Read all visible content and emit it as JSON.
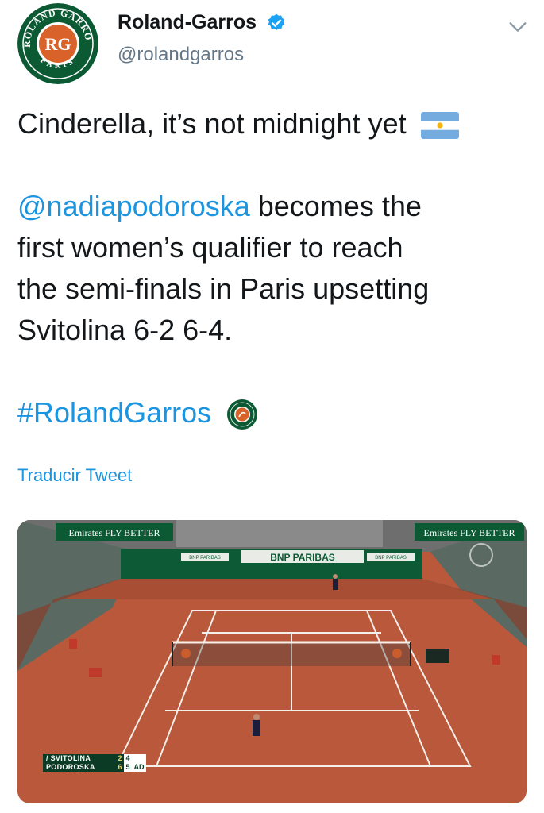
{
  "tweet": {
    "author": {
      "display_name": "Roland-Garros",
      "handle": "@rolandgarros",
      "verified": true,
      "avatar_logo_text_top": "ROLAND GARROS",
      "avatar_logo_text_bottom": "PARIS",
      "avatar_logo_monogram": "RG"
    },
    "text": {
      "line1": "Cinderella, it’s not midnight yet",
      "flag_icon": "argentina-flag-icon",
      "mention": "@nadiapodoroska",
      "line2_rest": " becomes the",
      "line3": "first women’s qualifier to reach",
      "line4": "the semi-finals in Paris upsetting",
      "line5": "Svitolina 6-2 6-4.",
      "hashtag": "#RolandGarros"
    },
    "translate_label": "Traducir Tweet",
    "menu_icon": "chevron-down-icon"
  },
  "media": {
    "board_left": "Emirates FLY BETTER",
    "board_right": "Emirates FLY BETTER",
    "sponsor_center": "BNP PARIBAS",
    "sponsor_small": "BNP PARIBAS",
    "scoreboard": {
      "player1": {
        "name": "/ SVITOLINA",
        "sets": "2",
        "games": "4",
        "points": ""
      },
      "player2": {
        "name": "PODOROSKA",
        "sets": "6",
        "games": "5",
        "points": "AD"
      }
    }
  },
  "colors": {
    "link": "#1b95e0",
    "text": "#14171a",
    "secondary": "#657786",
    "clay": "#b6563a",
    "rg_green": "#0b5a34",
    "rg_orange": "#d9622b"
  }
}
